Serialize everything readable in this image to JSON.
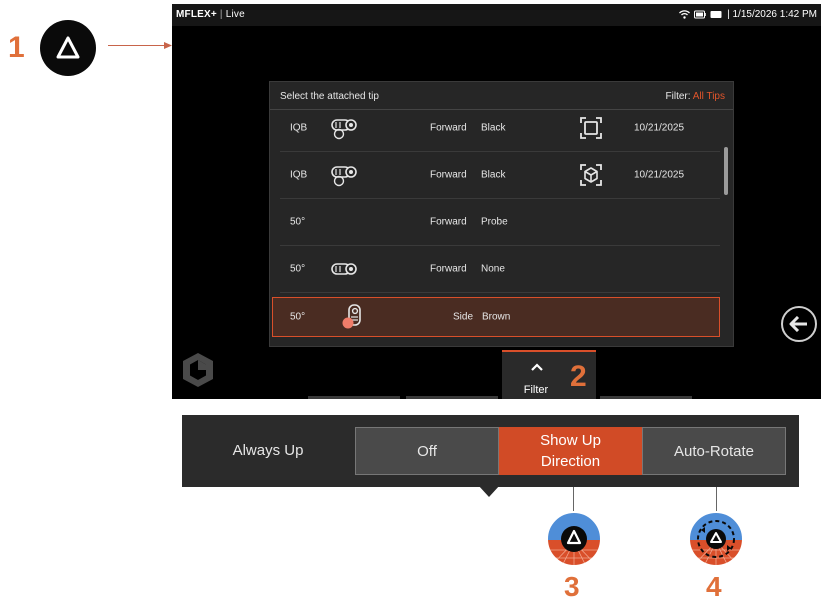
{
  "callouts": {
    "one": "1",
    "two": "2",
    "three": "3",
    "four": "4"
  },
  "status": {
    "app": "MFLEX+",
    "separator": "|",
    "mode": "Live",
    "datetime": "| 1/15/2026  1:42 PM"
  },
  "dialog": {
    "title": "Select the attached tip",
    "filter_label": "Filter:",
    "filter_value": "All Tips",
    "rows": [
      {
        "fov": "IQB",
        "icon": "tip-forward-icon",
        "direction": "Forward",
        "type": "Black",
        "mode_icon": "frame-measure-icon",
        "date": "10/21/2025",
        "selected": false
      },
      {
        "fov": "IQB",
        "icon": "tip-forward-icon",
        "direction": "Forward",
        "type": "Black",
        "mode_icon": "3d-cube-icon",
        "date": "10/21/2025",
        "selected": false
      },
      {
        "fov": "50°",
        "icon": "",
        "direction": "Forward",
        "type": "Probe",
        "mode_icon": "",
        "date": "",
        "selected": false
      },
      {
        "fov": "50°",
        "icon": "tip-forward-plain-icon",
        "direction": "Forward",
        "type": "None",
        "mode_icon": "",
        "date": "",
        "selected": false
      },
      {
        "fov": "50°",
        "icon": "tip-side-icon",
        "direction": "Side",
        "type": "Brown",
        "mode_icon": "",
        "date": "",
        "selected": true
      }
    ]
  },
  "filter_tab": {
    "label": "Filter"
  },
  "always_up": {
    "label": "Always Up",
    "options": [
      "Off",
      "Show Up Direction",
      "Auto-Rotate"
    ],
    "selected": "Show Up Direction"
  },
  "colors": {
    "accent": "#d14b26",
    "callout": "#e0703a",
    "screen_bg": "#000000",
    "dialog_bg": "#262626"
  }
}
